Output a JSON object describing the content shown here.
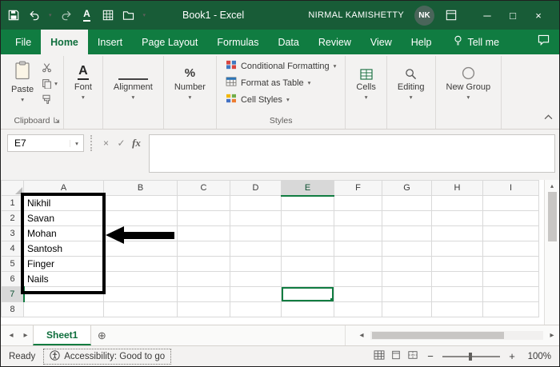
{
  "window": {
    "title": "Book1 - Excel",
    "user": {
      "name": "NIRMAL KAMISHETTY",
      "initials": "NK"
    }
  },
  "ribbon_tabs": {
    "items": [
      {
        "label": "File",
        "active": false
      },
      {
        "label": "Home",
        "active": true
      },
      {
        "label": "Insert",
        "active": false
      },
      {
        "label": "Page Layout",
        "active": false
      },
      {
        "label": "Formulas",
        "active": false
      },
      {
        "label": "Data",
        "active": false
      },
      {
        "label": "Review",
        "active": false
      },
      {
        "label": "View",
        "active": false
      },
      {
        "label": "Help",
        "active": false
      }
    ],
    "tell_me": "Tell me"
  },
  "ribbon": {
    "clipboard": {
      "paste": "Paste",
      "group_label": "Clipboard"
    },
    "font": {
      "label": "Font"
    },
    "alignment": {
      "label": "Alignment"
    },
    "number": {
      "label": "Number"
    },
    "styles": {
      "buttons": [
        "Conditional Formatting",
        "Format as Table",
        "Cell Styles"
      ],
      "group_label": "Styles"
    },
    "cells": {
      "label": "Cells"
    },
    "editing": {
      "label": "Editing"
    },
    "new_group": {
      "label": "New Group"
    }
  },
  "formula_bar": {
    "name_box": "E7",
    "fx_label": "fx",
    "value": ""
  },
  "grid": {
    "columns": [
      "A",
      "B",
      "C",
      "D",
      "E",
      "F",
      "G",
      "H",
      "I"
    ],
    "rows": [
      1,
      2,
      3,
      4,
      5,
      6,
      7,
      8
    ],
    "active_cell": {
      "column": "E",
      "row": 7
    },
    "column_a_values": [
      "Nikhil",
      "Savan",
      "Mohan",
      "Santosh",
      "Finger",
      "Nails"
    ]
  },
  "sheet_bar": {
    "sheets": [
      {
        "name": "Sheet1",
        "active": true
      }
    ]
  },
  "status_bar": {
    "mode": "Ready",
    "accessibility": "Accessibility: Good to go",
    "zoom_level": "100%"
  },
  "icons": {
    "letter_a": "A",
    "percent": "%",
    "dropdown_caret": "▾",
    "up_arrow": "▴",
    "left_arrow": "◂",
    "right_arrow": "▸",
    "minimize": "─",
    "maximize": "□",
    "close": "×",
    "cancel": "×",
    "check": "✓",
    "add_sheet": "⊕",
    "zoom_out": "−",
    "zoom_in": "+"
  },
  "colors": {
    "title_bar_green": "#185C37",
    "ribbon_green": "#107C41",
    "accent_green": "#107C41",
    "ribbon_bg": "#F3F2F1"
  }
}
